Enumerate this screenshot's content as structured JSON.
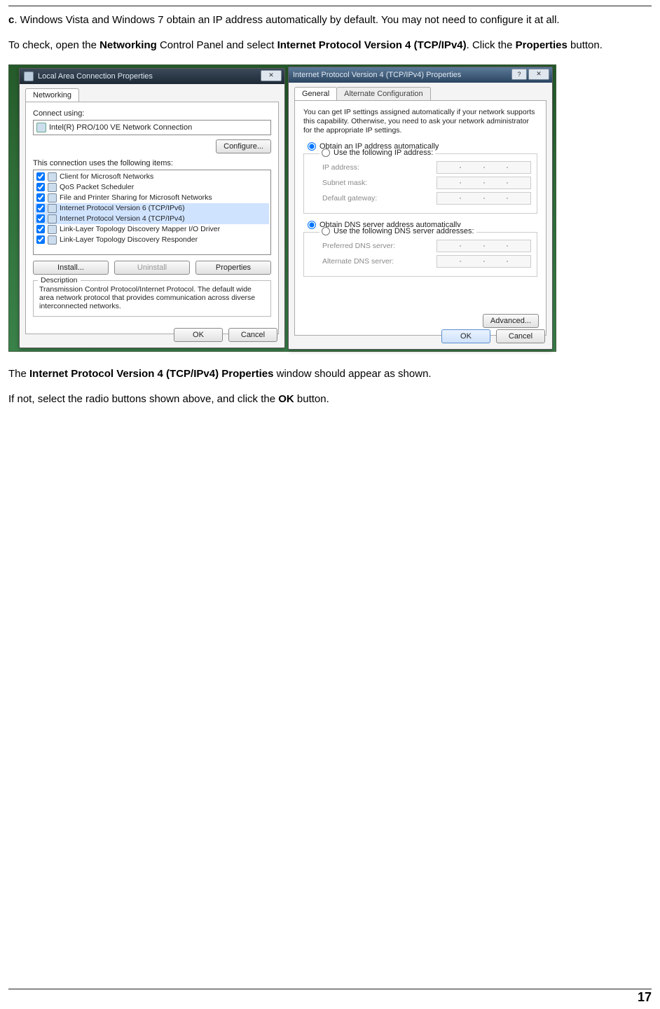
{
  "intro": {
    "c_label": "c",
    "c_text": ". Windows Vista and Windows 7 obtain an IP address automatically by default. You may not need to configure it at all.",
    "check_pre": "To check, open the ",
    "bold1": "Networking",
    "check_mid1": " Control Panel and select ",
    "bold2": "Internet Protocol Version 4 (TCP/IPv4)",
    "check_mid2": ". Click the ",
    "bold3": "Properties",
    "check_post": " button."
  },
  "dlg1": {
    "title": "Local Area Connection Properties",
    "tab": "Networking",
    "connect_using": "Connect using:",
    "adapter": "Intel(R) PRO/100 VE Network Connection",
    "configure": "Configure...",
    "items_label": "This connection uses the following items:",
    "items": [
      "Client for Microsoft Networks",
      "QoS Packet Scheduler",
      "File and Printer Sharing for Microsoft Networks",
      "Internet Protocol Version 6 (TCP/IPv6)",
      "Internet Protocol Version 4 (TCP/IPv4)",
      "Link-Layer Topology Discovery Mapper I/O Driver",
      "Link-Layer Topology Discovery Responder"
    ],
    "install": "Install...",
    "uninstall": "Uninstall",
    "properties": "Properties",
    "desc_legend": "Description",
    "desc_text": "Transmission Control Protocol/Internet Protocol. The default wide area network protocol that provides communication across diverse interconnected networks.",
    "ok": "OK",
    "cancel": "Cancel"
  },
  "dlg2": {
    "title": "Internet Protocol Version 4 (TCP/IPv4) Properties",
    "tab_general": "General",
    "tab_alt": "Alternate Configuration",
    "intro": "You can get IP settings assigned automatically if your network supports this capability. Otherwise, you need to ask your network administrator for the appropriate IP settings.",
    "r_auto_ip": "Obtain an IP address automatically",
    "r_use_ip": "Use the following IP address:",
    "ip_label": "IP address:",
    "subnet_label": "Subnet mask:",
    "gateway_label": "Default gateway:",
    "r_auto_dns": "Obtain DNS server address automatically",
    "r_use_dns": "Use the following DNS server addresses:",
    "pref_dns": "Preferred DNS server:",
    "alt_dns": "Alternate DNS server:",
    "advanced": "Advanced...",
    "ok": "OK",
    "cancel": "Cancel"
  },
  "outro": {
    "p1_pre": "The ",
    "p1_bold": "Internet Protocol Version 4 (TCP/IPv4) Properties",
    "p1_post": " window should appear as shown.",
    "p2_pre": "If not, select the radio buttons shown above, and click the ",
    "p2_bold": "OK",
    "p2_post": " button."
  },
  "page_number": "17"
}
